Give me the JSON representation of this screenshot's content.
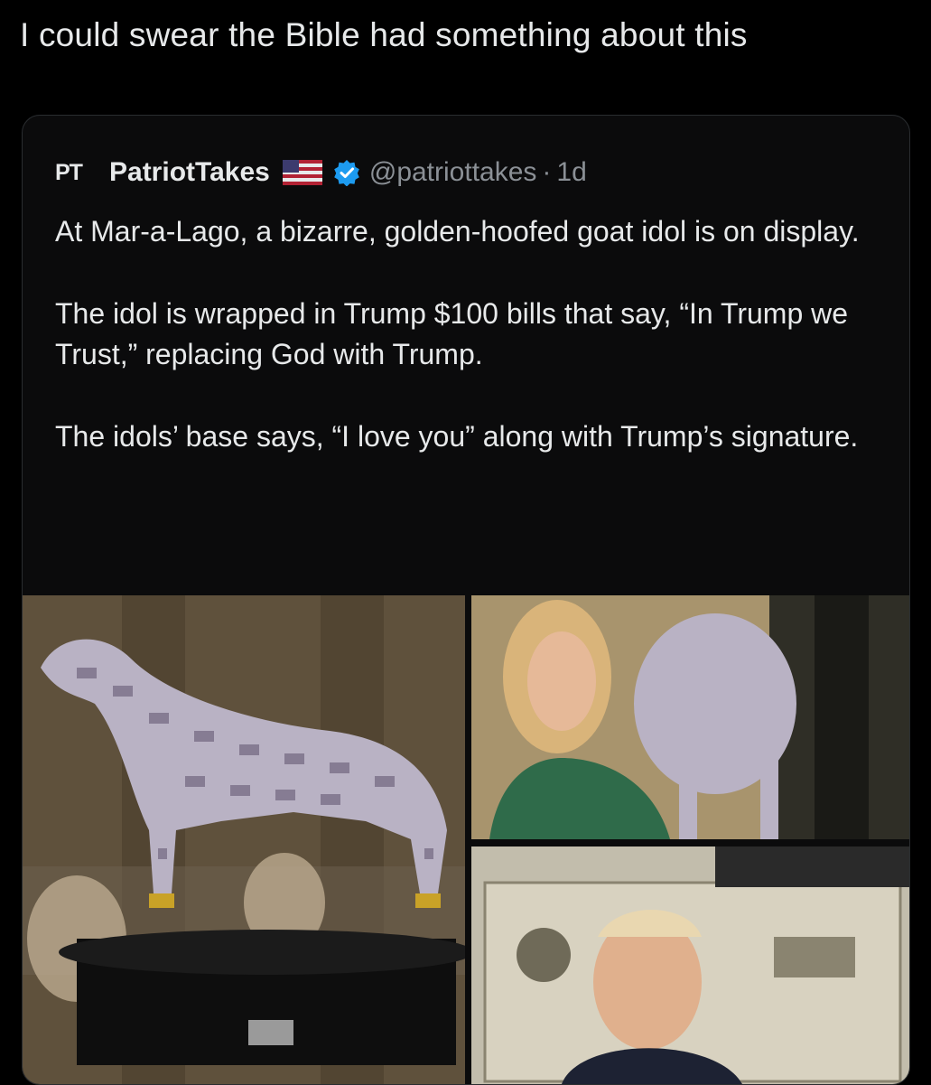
{
  "caption": "I could swear the Bible had something about this",
  "quote": {
    "avatar_text": "PT",
    "author_name": "PatriotTakes",
    "handle": "@patriottakes",
    "separator": "·",
    "time": "1d",
    "paragraphs": [
      "At Mar-a-Lago, a bizarre, golden-hoofed goat idol is on display.",
      "The idol is wrapped in Trump $100 bills that say, “In Trump we Trust,” replacing God with Trump.",
      "The idols’ base says, “I love you” along with Trump’s signature."
    ]
  },
  "icons": {
    "flag": "us-flag-icon",
    "verified": "verified-badge-icon"
  },
  "colors": {
    "background": "#000000",
    "text": "#e7e9ea",
    "muted": "#8b9096",
    "verified_blue": "#1d9bf0"
  }
}
